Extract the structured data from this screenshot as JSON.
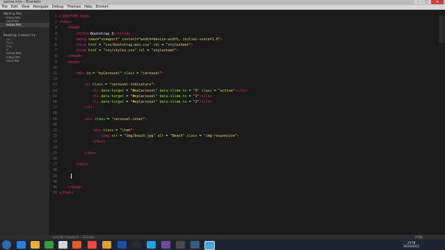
{
  "window": {
    "title": "extras.htm - Brackets",
    "min": "–",
    "max": "□",
    "close": "✕"
  },
  "menu": [
    "File",
    "Edit",
    "View",
    "Navigate",
    "Debug",
    "Themes",
    "Help",
    "Emmet"
  ],
  "sidebar": {
    "working_files_header": "Working Files",
    "working_files": [
      "index.htm",
      "read.htm",
      "extras.htm"
    ],
    "folder_header": "Bootstrap 3 Lesson 3 ▾",
    "folder_items": [
      "css",
      "fonts",
      "img",
      "js",
      "extras.htm",
      "index.htm",
      "read.htm"
    ]
  },
  "editor": {
    "line_numbers": [
      "1",
      "2",
      "3",
      "4",
      "5",
      "6",
      "7",
      "8",
      "9",
      "10",
      "11",
      "12",
      "13",
      "14",
      "15",
      "16",
      "17",
      "18",
      "19",
      "20",
      "21",
      "22",
      "23",
      "24",
      "25",
      "26",
      "27",
      "28",
      "29",
      "30",
      "31",
      "32"
    ],
    "lines": [
      [
        {
          "c": "t",
          "v": "<!DOCTYPE html>"
        }
      ],
      [
        {
          "c": "t",
          "v": "<html>"
        }
      ],
      [
        {
          "c": "t",
          "v": "    <head>"
        }
      ],
      [
        {
          "c": "t",
          "v": "        <title>"
        },
        {
          "c": "p",
          "v": "Bootstrap 3"
        },
        {
          "c": "t",
          "v": "</title>"
        }
      ],
      [
        {
          "c": "t",
          "v": "        <meta "
        },
        {
          "c": "a",
          "v": "name"
        },
        {
          "c": "p",
          "v": "="
        },
        {
          "c": "s",
          "v": "\"viewport\""
        },
        {
          "c": "a",
          "v": " content"
        },
        {
          "c": "p",
          "v": "="
        },
        {
          "c": "s",
          "v": "\"width=device-width, initial-scale=1.0\""
        },
        {
          "c": "t",
          "v": ">"
        }
      ],
      [
        {
          "c": "t",
          "v": "        <link "
        },
        {
          "c": "a",
          "v": "href"
        },
        {
          "c": "p",
          "v": " = "
        },
        {
          "c": "s",
          "v": "\"css/bootstrap.min.css\""
        },
        {
          "c": "a",
          "v": " rel"
        },
        {
          "c": "p",
          "v": " = "
        },
        {
          "c": "s",
          "v": "\"stylesheet\""
        },
        {
          "c": "t",
          "v": ">"
        }
      ],
      [
        {
          "c": "t",
          "v": "        <link "
        },
        {
          "c": "a",
          "v": "href"
        },
        {
          "c": "p",
          "v": " = "
        },
        {
          "c": "s",
          "v": "\"css/styles.css\""
        },
        {
          "c": "a",
          "v": " rel"
        },
        {
          "c": "p",
          "v": " = "
        },
        {
          "c": "s",
          "v": "\"stylesheet\""
        },
        {
          "c": "t",
          "v": ">"
        }
      ],
      [
        {
          "c": "t",
          "v": "    </head>"
        }
      ],
      [
        {
          "c": "t",
          "v": "    <body>"
        }
      ],
      [
        {
          "c": "p",
          "v": ""
        }
      ],
      [
        {
          "c": "t",
          "v": "        <div "
        },
        {
          "c": "a",
          "v": "id"
        },
        {
          "c": "p",
          "v": " = "
        },
        {
          "c": "s",
          "v": "\"myCarousel\""
        },
        {
          "c": "a",
          "v": " class"
        },
        {
          "c": "p",
          "v": " = "
        },
        {
          "c": "s",
          "v": "\"carousel\""
        },
        {
          "c": "t",
          "v": ">"
        }
      ],
      [
        {
          "c": "p",
          "v": ""
        }
      ],
      [
        {
          "c": "t",
          "v": "            <ol "
        },
        {
          "c": "a",
          "v": "class"
        },
        {
          "c": "p",
          "v": " = "
        },
        {
          "c": "s",
          "v": "\"carousel-indicators\""
        },
        {
          "c": "t",
          "v": ">"
        }
      ],
      [
        {
          "c": "t",
          "v": "                <li "
        },
        {
          "c": "a",
          "v": "data-target"
        },
        {
          "c": "p",
          "v": " = "
        },
        {
          "c": "s",
          "v": "\"#myCarousel\""
        },
        {
          "c": "a",
          "v": " data-slide-to"
        },
        {
          "c": "p",
          "v": " = "
        },
        {
          "c": "s",
          "v": "\"0\""
        },
        {
          "c": "a",
          "v": " class"
        },
        {
          "c": "p",
          "v": " = "
        },
        {
          "c": "s",
          "v": "\"active\""
        },
        {
          "c": "t",
          "v": "></li>"
        }
      ],
      [
        {
          "c": "t",
          "v": "                <li "
        },
        {
          "c": "a",
          "v": "data-target"
        },
        {
          "c": "p",
          "v": " = "
        },
        {
          "c": "s",
          "v": "\"#myCarousel\""
        },
        {
          "c": "a",
          "v": " data-slide-to"
        },
        {
          "c": "p",
          "v": " = "
        },
        {
          "c": "s",
          "v": "\"1\""
        },
        {
          "c": "t",
          "v": "></li>"
        }
      ],
      [
        {
          "c": "t",
          "v": "                <li "
        },
        {
          "c": "a",
          "v": "data-target"
        },
        {
          "c": "p",
          "v": " = "
        },
        {
          "c": "s",
          "v": "\"#myCarousel\""
        },
        {
          "c": "a",
          "v": " data-slide-to"
        },
        {
          "c": "p",
          "v": " = "
        },
        {
          "c": "s",
          "v": "\"2\""
        },
        {
          "c": "t",
          "v": "></li>"
        }
      ],
      [
        {
          "c": "t",
          "v": "            </ol>"
        }
      ],
      [
        {
          "c": "p",
          "v": ""
        }
      ],
      [
        {
          "c": "t",
          "v": "            <div "
        },
        {
          "c": "a",
          "v": "class"
        },
        {
          "c": "p",
          "v": " = "
        },
        {
          "c": "s",
          "v": "\"carousel-inner\""
        },
        {
          "c": "t",
          "v": ">"
        }
      ],
      [
        {
          "c": "p",
          "v": ""
        }
      ],
      [
        {
          "c": "t",
          "v": "                <div "
        },
        {
          "c": "a",
          "v": "class"
        },
        {
          "c": "p",
          "v": " = "
        },
        {
          "c": "s",
          "v": "\"item\""
        },
        {
          "c": "t",
          "v": ">"
        }
      ],
      [
        {
          "c": "t",
          "v": "                    <img "
        },
        {
          "c": "a",
          "v": "src"
        },
        {
          "c": "p",
          "v": " = "
        },
        {
          "c": "s",
          "v": "\"img/beach.jpg\""
        },
        {
          "c": "a",
          "v": " alt"
        },
        {
          "c": "p",
          "v": " = "
        },
        {
          "c": "s",
          "v": "\"Beach\""
        },
        {
          "c": "a",
          "v": " class"
        },
        {
          "c": "p",
          "v": " = "
        },
        {
          "c": "s",
          "v": "\"img-responsive\""
        },
        {
          "c": "t",
          "v": ">"
        }
      ],
      [
        {
          "c": "t",
          "v": "                </div>"
        }
      ],
      [
        {
          "c": "p",
          "v": ""
        }
      ],
      [
        {
          "c": "t",
          "v": "            </div>"
        }
      ],
      [
        {
          "c": "p",
          "v": ""
        }
      ],
      [
        {
          "c": "t",
          "v": "        </div>"
        }
      ],
      [
        {
          "c": "p",
          "v": ""
        }
      ],
      [
        {
          "c": "p",
          "v": ""
        }
      ],
      [
        {
          "c": "p",
          "v": ""
        }
      ],
      [
        {
          "c": "t",
          "v": "    </body>"
        }
      ],
      [
        {
          "c": "t",
          "v": "</html>"
        }
      ]
    ]
  },
  "status": {
    "left": "Line 28, Column 9 — 32 Lines",
    "right": "HTML"
  },
  "taskbar": {
    "icons": [
      "ie-icon",
      "explorer-icon",
      "media-icon",
      "firefox-icon",
      "chrome-icon",
      "photoshop-icon",
      "skype-icon",
      "filezilla-icon",
      "paint-icon",
      "word-icon",
      "vlc-icon",
      "brackets-icon"
    ],
    "time": "23:58",
    "date": "26/10/2013"
  }
}
